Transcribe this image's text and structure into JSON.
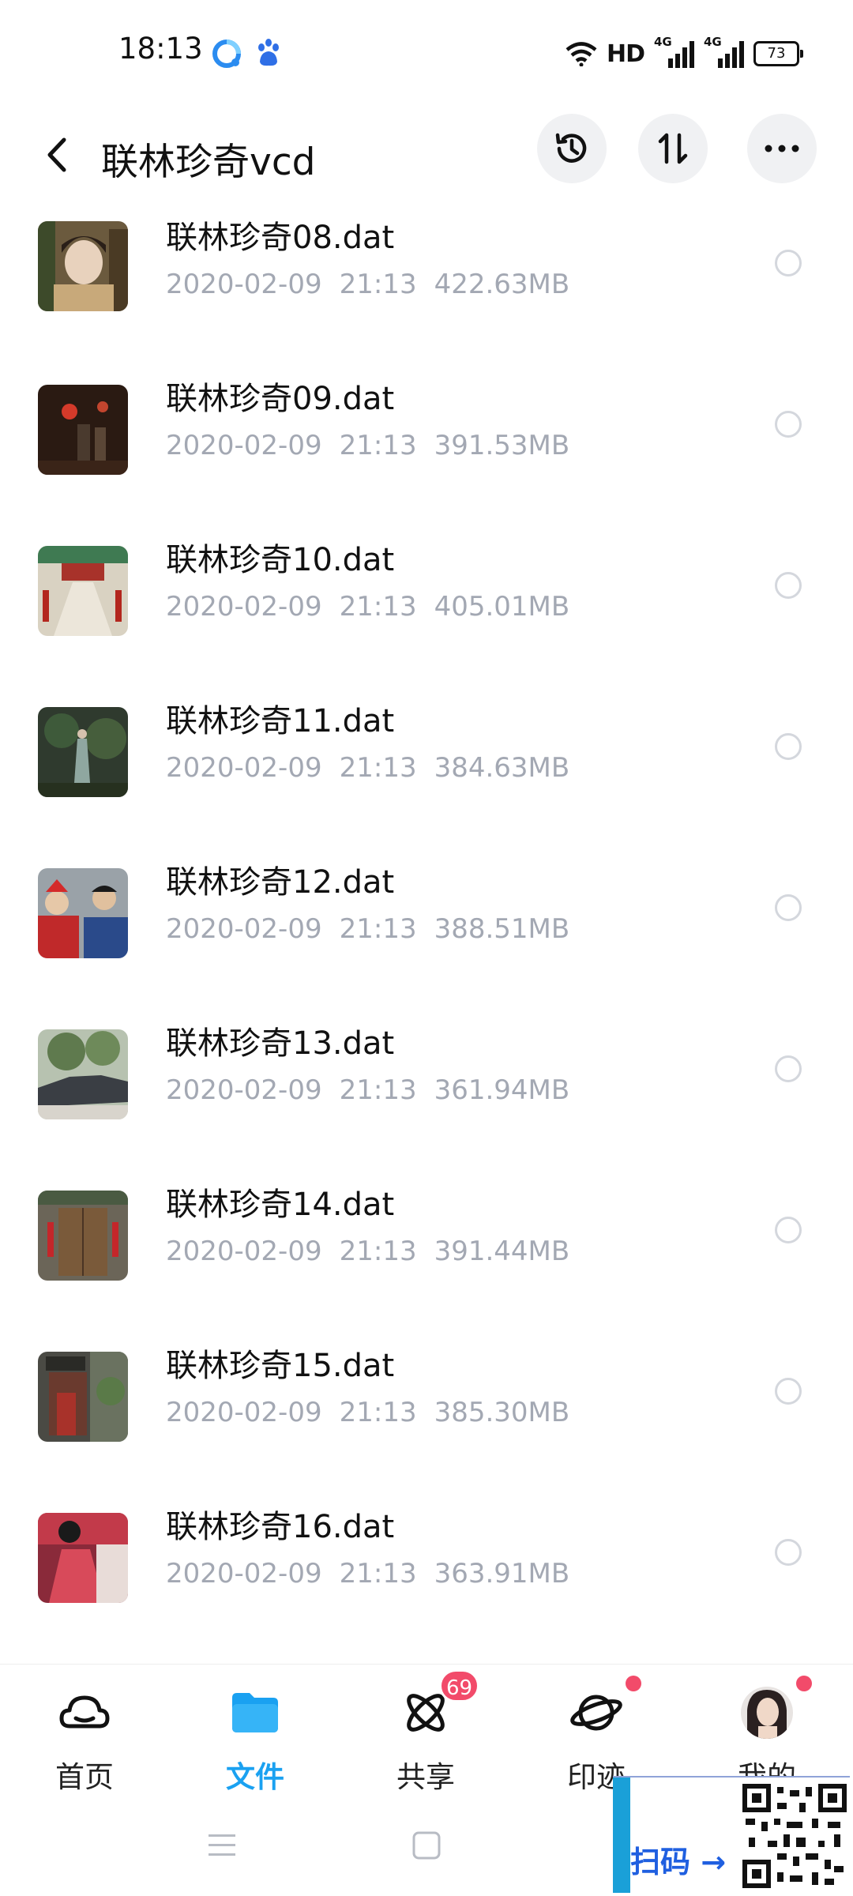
{
  "status_bar": {
    "time": "18:13",
    "hd_label": "HD",
    "network_1": "4G",
    "network_2": "4G",
    "battery": "73"
  },
  "header": {
    "title": "联林珍奇vcd",
    "icons": [
      "back-chevron-icon",
      "history-clock-icon",
      "sort-arrows-icon",
      "more-dots-icon"
    ]
  },
  "files": [
    {
      "name": "联林珍奇08.dat",
      "date": "2020-02-09",
      "time": "21:13",
      "size": "422.63MB"
    },
    {
      "name": "联林珍奇09.dat",
      "date": "2020-02-09",
      "time": "21:13",
      "size": "391.53MB"
    },
    {
      "name": "联林珍奇10.dat",
      "date": "2020-02-09",
      "time": "21:13",
      "size": "405.01MB"
    },
    {
      "name": "联林珍奇11.dat",
      "date": "2020-02-09",
      "time": "21:13",
      "size": "384.63MB"
    },
    {
      "name": "联林珍奇12.dat",
      "date": "2020-02-09",
      "time": "21:13",
      "size": "388.51MB"
    },
    {
      "name": "联林珍奇13.dat",
      "date": "2020-02-09",
      "time": "21:13",
      "size": "361.94MB"
    },
    {
      "name": "联林珍奇14.dat",
      "date": "2020-02-09",
      "time": "21:13",
      "size": "391.44MB"
    },
    {
      "name": "联林珍奇15.dat",
      "date": "2020-02-09",
      "time": "21:13",
      "size": "385.30MB"
    },
    {
      "name": "联林珍奇16.dat",
      "date": "2020-02-09",
      "time": "21:13",
      "size": "363.91MB"
    }
  ],
  "bottom_nav": [
    {
      "label": "首页",
      "icon": "cloud-icon",
      "active": false
    },
    {
      "label": "文件",
      "icon": "folder-icon",
      "active": true
    },
    {
      "label": "共享",
      "icon": "share-atom-icon",
      "badge": "69"
    },
    {
      "label": "印迹",
      "icon": "planet-icon",
      "dot": true
    },
    {
      "label": "我的",
      "icon": "avatar-icon",
      "dot": true
    }
  ],
  "watermark": {
    "text": "扫码 →"
  },
  "colors": {
    "accent": "#1aa1f1",
    "badge": "#f24b6a",
    "meta_text": "#a3a8b3",
    "round_button_bg": "#f0f1f3"
  }
}
